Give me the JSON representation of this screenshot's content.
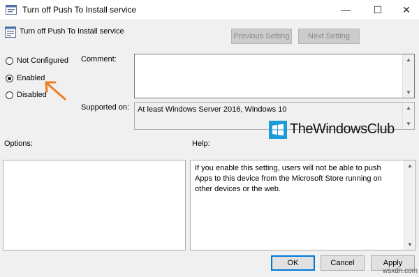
{
  "window": {
    "title": "Turn off Push To Install service",
    "minimize_glyph": "—",
    "maximize_glyph": "☐",
    "close_glyph": "✕"
  },
  "header": {
    "title": "Turn off Push To Install service",
    "previous_label": "Previous Setting",
    "next_label": "Next Setting"
  },
  "state": {
    "options": [
      {
        "label": "Not Configured",
        "checked": false
      },
      {
        "label": "Enabled",
        "checked": true
      },
      {
        "label": "Disabled",
        "checked": false
      }
    ]
  },
  "comment": {
    "label": "Comment:",
    "value": ""
  },
  "supported": {
    "label": "Supported on:",
    "value": "At least Windows Server 2016, Windows 10"
  },
  "options_section": {
    "label": "Options:"
  },
  "help": {
    "label": "Help:",
    "text": "If you enable this setting, users will not be able to push Apps to this device from the Microsoft Store running on other devices or the web."
  },
  "buttons": {
    "ok": "OK",
    "cancel": "Cancel",
    "apply": "Apply"
  },
  "watermark": {
    "text": "TheWindowsClub"
  },
  "source_mark": "wsxdn.com",
  "colors": {
    "accent": "#0078d7",
    "arrow": "#f07c1e",
    "watermark_blue": "#1d9bd9"
  },
  "icons": [
    "policy-icon",
    "minimize-icon",
    "maximize-icon",
    "close-icon",
    "windows-logo-icon",
    "arrow-annotation-icon"
  ]
}
